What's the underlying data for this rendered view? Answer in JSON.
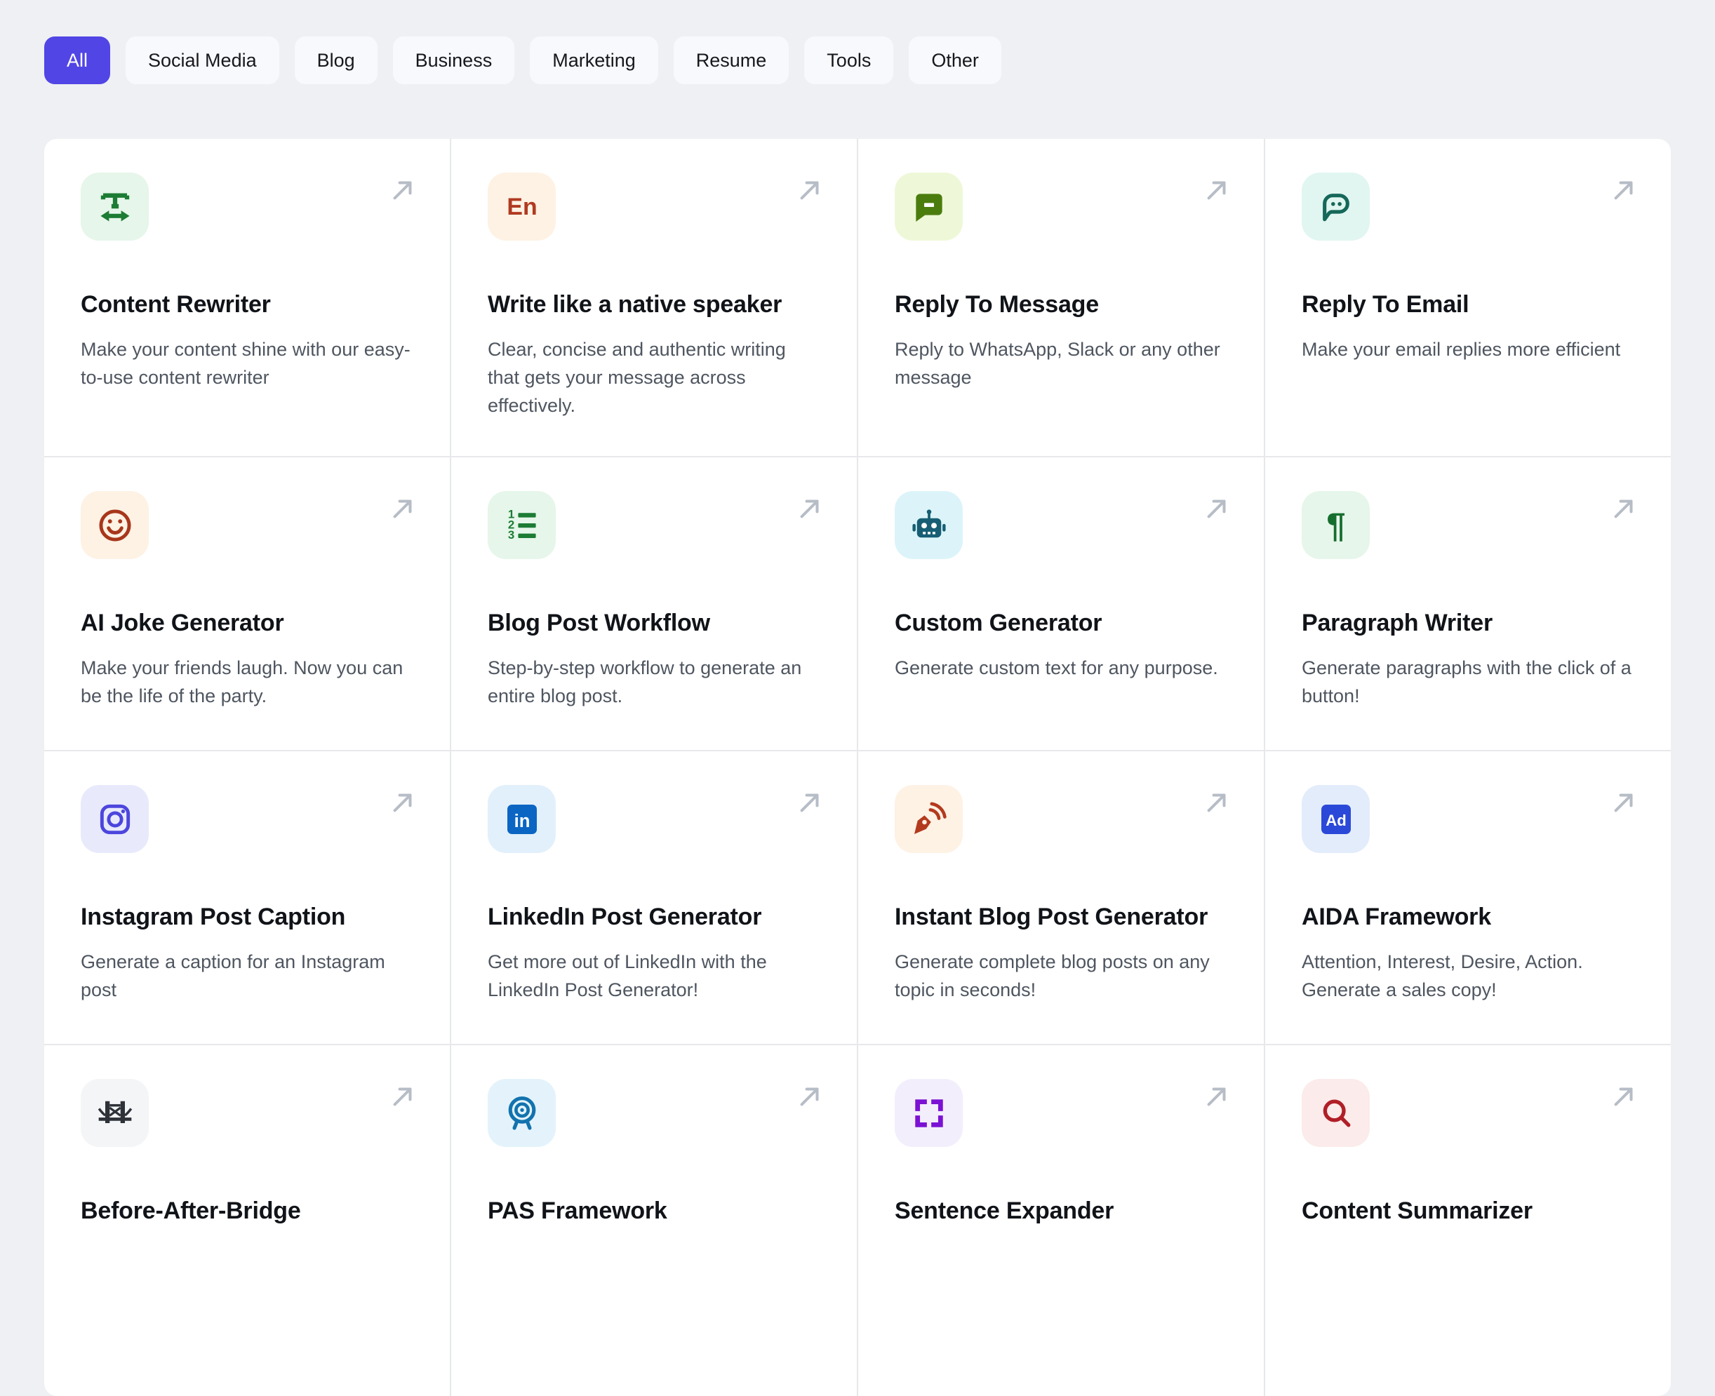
{
  "page": {
    "background": "#eef0f3",
    "accent": "#5145e5"
  },
  "filter_tabs": [
    {
      "label": "All",
      "active": true
    },
    {
      "label": "Social Media",
      "active": false
    },
    {
      "label": "Blog",
      "active": false
    },
    {
      "label": "Business",
      "active": false
    },
    {
      "label": "Marketing",
      "active": false
    },
    {
      "label": "Resume",
      "active": false
    },
    {
      "label": "Tools",
      "active": false
    },
    {
      "label": "Other",
      "active": false
    }
  ],
  "cards": [
    {
      "title": "Content Rewriter",
      "description": "Make your content shine with our easy-to-use content rewriter",
      "icon": "text-width-icon",
      "icon_fg": "#1c7c34",
      "icon_bg": "#e6f6ea"
    },
    {
      "title": "Write like a native speaker",
      "description": "Clear, concise and authentic writing that gets your message across effectively.",
      "icon": "english-text-icon",
      "icon_fg": "#b03a21",
      "icon_bg": "#fdf2e4",
      "icon_text": "En"
    },
    {
      "title": "Reply To Message",
      "description": "Reply to WhatsApp, Slack or any other message",
      "icon": "chat-bubble-icon",
      "icon_fg": "#4b7d0e",
      "icon_bg": "#eef8d8"
    },
    {
      "title": "Reply To Email",
      "description": "Make your email replies more efficient",
      "icon": "chat-face-icon",
      "icon_fg": "#15685a",
      "icon_bg": "#e1f6f0"
    },
    {
      "title": "AI Joke Generator",
      "description": "Make your friends laugh. Now you can be the life of the party.",
      "icon": "smiley-icon",
      "icon_fg": "#a8361b",
      "icon_bg": "#fdf2e4"
    },
    {
      "title": "Blog Post Workflow",
      "description": "Step-by-step workflow to generate an entire blog post.",
      "icon": "numbered-list-icon",
      "icon_fg": "#1c7c34",
      "icon_bg": "#e6f6ea"
    },
    {
      "title": "Custom Generator",
      "description": "Generate custom text for any purpose.",
      "icon": "robot-icon",
      "icon_fg": "#175e74",
      "icon_bg": "#dcf4f9"
    },
    {
      "title": "Paragraph Writer",
      "description": "Generate paragraphs with the click of a button!",
      "icon": "pilcrow-icon",
      "icon_fg": "#166e2e",
      "icon_bg": "#e6f6ea",
      "icon_text": "¶"
    },
    {
      "title": "Instagram Post Caption",
      "description": "Generate a caption for an Instagram post",
      "icon": "instagram-icon",
      "icon_fg": "#4c46dd",
      "icon_bg": "#e8eafc"
    },
    {
      "title": "LinkedIn Post Generator",
      "description": "Get more out of LinkedIn with the LinkedIn Post Generator!",
      "icon": "linkedin-icon",
      "icon_fg": "#0a66c2",
      "icon_bg": "#e2f0fb",
      "icon_text": "in"
    },
    {
      "title": "Instant Blog Post Generator",
      "description": "Generate complete blog posts on any topic in seconds!",
      "icon": "pen-signal-icon",
      "icon_fg": "#b33a1e",
      "icon_bg": "#fdf2e4"
    },
    {
      "title": "AIDA Framework",
      "description": "Attention, Interest, Desire, Action. Generate a sales copy!",
      "icon": "ad-badge-icon",
      "icon_fg": "#2b49d8",
      "icon_bg": "#e3ecfb",
      "icon_text": "Ad"
    },
    {
      "title": "Before-After-Bridge",
      "description": "",
      "icon": "bridge-icon",
      "icon_fg": "#2e3238",
      "icon_bg": "#f4f5f7"
    },
    {
      "title": "PAS Framework",
      "description": "",
      "icon": "target-icon",
      "icon_fg": "#1273ae",
      "icon_bg": "#e4f3fb"
    },
    {
      "title": "Sentence Expander",
      "description": "",
      "icon": "expand-icon",
      "icon_fg": "#7b12d4",
      "icon_bg": "#f3eefc"
    },
    {
      "title": "Content Summarizer",
      "description": "",
      "icon": "magnifier-icon",
      "icon_fg": "#b01f27",
      "icon_bg": "#fcebeb"
    }
  ]
}
